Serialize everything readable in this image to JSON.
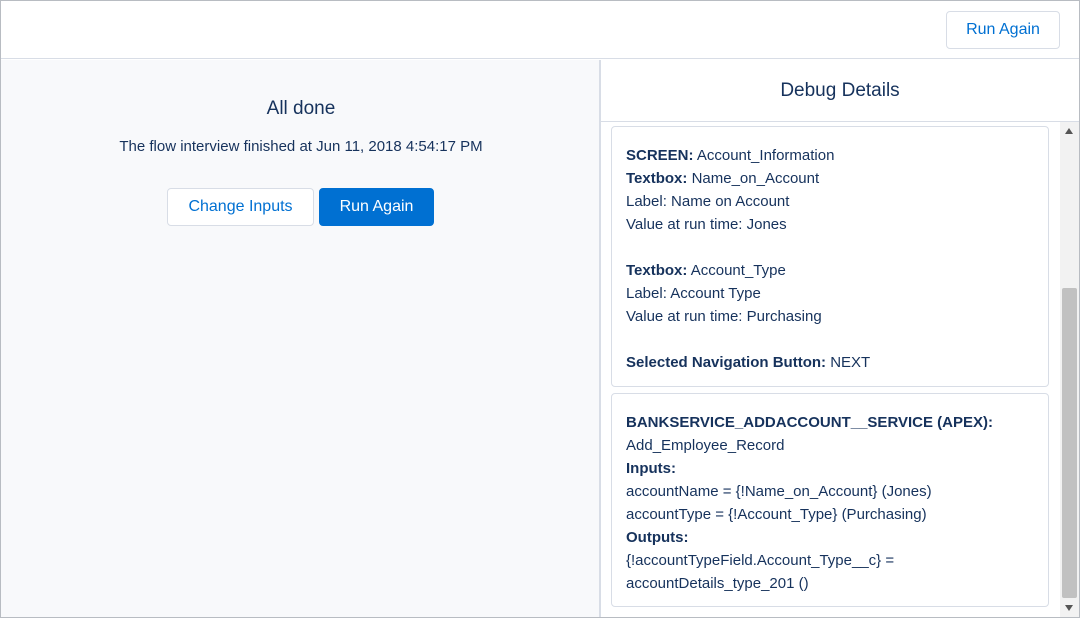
{
  "header": {
    "run_again_label": "Run Again"
  },
  "main": {
    "title": "All done",
    "finished_text": "The flow interview finished at Jun 11, 2018 4:54:17 PM",
    "change_inputs_label": "Change Inputs",
    "run_again_label": "Run Again"
  },
  "debug": {
    "title": "Debug Details",
    "screen_card": {
      "screen_label": "SCREEN:",
      "screen_value": " Account_Information",
      "textbox1_label": "Textbox:",
      "textbox1_value": " Name_on_Account",
      "textbox1_field_label": "Label: Name on Account",
      "textbox1_runtime": "Value at run time: Jones",
      "textbox2_label": "Textbox:",
      "textbox2_value": " Account_Type",
      "textbox2_field_label": "Label: Account Type",
      "textbox2_runtime": "Value at run time: Purchasing",
      "nav_label": "Selected Navigation Button:",
      "nav_value": " NEXT"
    },
    "apex_card": {
      "heading": "BANKSERVICE_ADDACCOUNT__SERVICE (APEX):",
      "record": "Add_Employee_Record",
      "inputs_label": "Inputs:",
      "input1": "accountName = {!Name_on_Account} (Jones)",
      "input2": "accountType = {!Account_Type} (Purchasing)",
      "outputs_label": "Outputs:",
      "output1": "{!accountTypeField.Account_Type__c} =",
      "output2": "accountDetails_type_201 ()"
    }
  },
  "colors": {
    "brand": "#0070d2",
    "text": "#16325c",
    "border": "#d8dde6",
    "left_pane_bg": "#f8f9fb"
  }
}
